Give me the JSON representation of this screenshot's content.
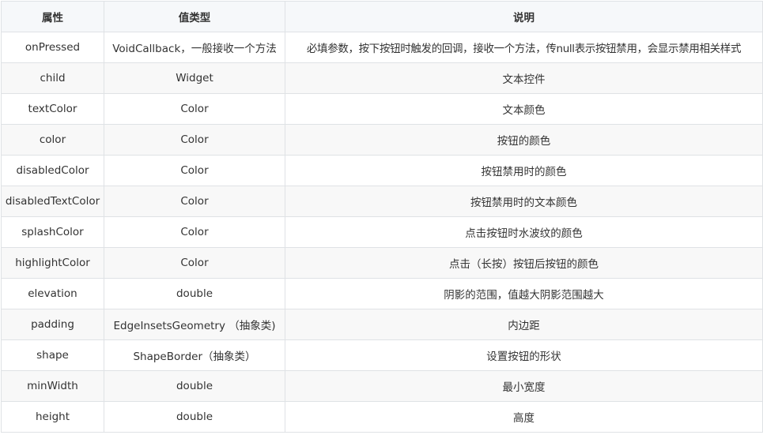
{
  "table": {
    "headers": [
      "属性",
      "值类型",
      "说明"
    ],
    "rows": [
      {
        "property": "onPressed",
        "type": "VoidCallback，一般接收一个方法",
        "description": "必填参数，按下按钮时触发的回调，接收一个方法，传null表示按钮禁用，会显示禁用相关样式"
      },
      {
        "property": "child",
        "type": "Widget",
        "description": "文本控件"
      },
      {
        "property": "textColor",
        "type": "Color",
        "description": "文本颜色"
      },
      {
        "property": "color",
        "type": "Color",
        "description": "按钮的颜色"
      },
      {
        "property": "disabledColor",
        "type": "Color",
        "description": "按钮禁用时的颜色"
      },
      {
        "property": "disabledTextColor",
        "type": "Color",
        "description": "按钮禁用时的文本颜色"
      },
      {
        "property": "splashColor",
        "type": "Color",
        "description": "点击按钮时水波纹的颜色"
      },
      {
        "property": "highlightColor",
        "type": "Color",
        "description": "点击（长按）按钮后按钮的颜色"
      },
      {
        "property": "elevation",
        "type": "double",
        "description": "阴影的范围，值越大阴影范围越大"
      },
      {
        "property": "padding",
        "type": "EdgeInsetsGeometry （抽象类)",
        "description": "内边距"
      },
      {
        "property": "shape",
        "type": "ShapeBorder（抽象类）",
        "description": "设置按钮的形状"
      },
      {
        "property": "minWidth",
        "type": "double",
        "description": "最小宽度"
      },
      {
        "property": "height",
        "type": "double",
        "description": "高度"
      }
    ]
  }
}
